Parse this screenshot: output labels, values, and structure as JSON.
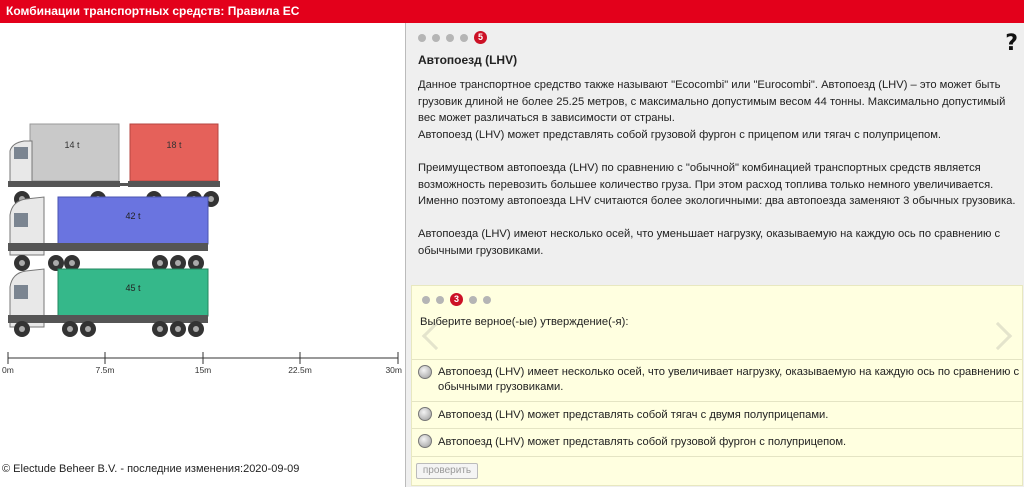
{
  "window": {
    "title": "Комбинации транспортных средств: Правила ЕС"
  },
  "section": {
    "active_step": "5",
    "title": "Автопоезд (LHV)",
    "paragraphs": [
      "Данное транспортное средство также называют \"Ecocombi\" или \"Eurocombi\". Автопоезд (LHV) – это может быть грузовик длиной не более 25.25 метров, с максимально допустимым весом 44 тонны. Максимально допустимый вес может различаться в зависимости от страны.",
      "Автопоезд (LHV) может представлять собой грузовой фургон с прицепом или тягач с полуприцепом.",
      "Преимуществом автопоезда (LHV) по сравнению с \"обычной\" комбинацией транспортных средств является возможность перевозить большее количество груза. При этом расход топлива только немного увеличивается. Именно поэтому автопоезда LHV считаются более экологичными: два автопоезда заменяют 3 обычных грузовика.",
      "Автопоезда (LHV) имеют несколько осей, что уменьшает нагрузку, оказываемую на каждую ось по сравнению с обычными грузовиками."
    ]
  },
  "quiz": {
    "active_step": "3",
    "prompt": "Выберите верное(-ые) утверждение(-я):",
    "options": [
      "Автопоезд (LHV) имеет несколько осей, что увеличивает нагрузку, оказываемую на каждую ось по сравнению с обычными грузовиками.",
      "Автопоезд (LHV) может представлять собой тягач с двумя полуприцепами.",
      "Автопоезд (LHV) может представлять собой грузовой фургон с полуприцепом."
    ],
    "check_label": "проверить"
  },
  "illustration": {
    "truck1": {
      "cargo_front": "14 t",
      "cargo_trailer": "18 t",
      "color_front": "#c8c8c8",
      "color_trailer": "#e5615a"
    },
    "truck2": {
      "cargo": "42 t",
      "color": "#6a74e0"
    },
    "truck3": {
      "cargo": "45 t",
      "color": "#35b88a"
    },
    "scale": [
      "0m",
      "7.5m",
      "15m",
      "22.5m",
      "30m"
    ]
  },
  "footer": {
    "copyright": "© Electude Beheer B.V. - последние изменения:2020-09-09"
  },
  "help_label": "?"
}
